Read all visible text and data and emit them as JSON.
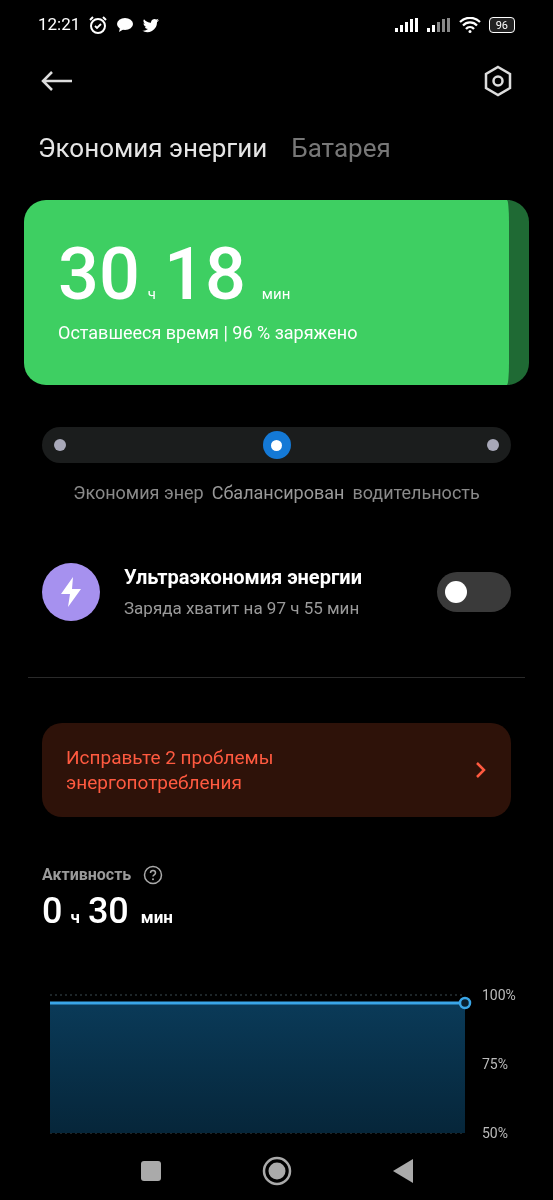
{
  "status_bar": {
    "time": "12:21",
    "battery": "96"
  },
  "tabs": [
    {
      "label": "Экономия энергии",
      "selected": true
    },
    {
      "label": "Батарея",
      "selected": false
    }
  ],
  "summary": {
    "hours": "30",
    "hours_unit": "ч",
    "minutes": "18",
    "minutes_unit": "мин",
    "caption": "Оставшееся время | 96 % заряжено"
  },
  "modes": [
    {
      "label": "Экономия энер",
      "selected": false
    },
    {
      "label": "Сбалансирован",
      "selected": true
    },
    {
      "label": "водительность",
      "selected": false
    }
  ],
  "ultra_saver": {
    "title": "Ультраэкономия энергии",
    "subtitle": "Заряда хватит на 97 ч 55 мин",
    "on": false
  },
  "issues_card": {
    "text": "Исправьте 2 проблемы энергопотребления"
  },
  "activity": {
    "title": "Активность",
    "hours": "0",
    "hours_unit": "ч",
    "minutes": "30",
    "minutes_unit": "мин",
    "chart_axis_labels": [
      "100%",
      "75%",
      "50%"
    ]
  }
}
